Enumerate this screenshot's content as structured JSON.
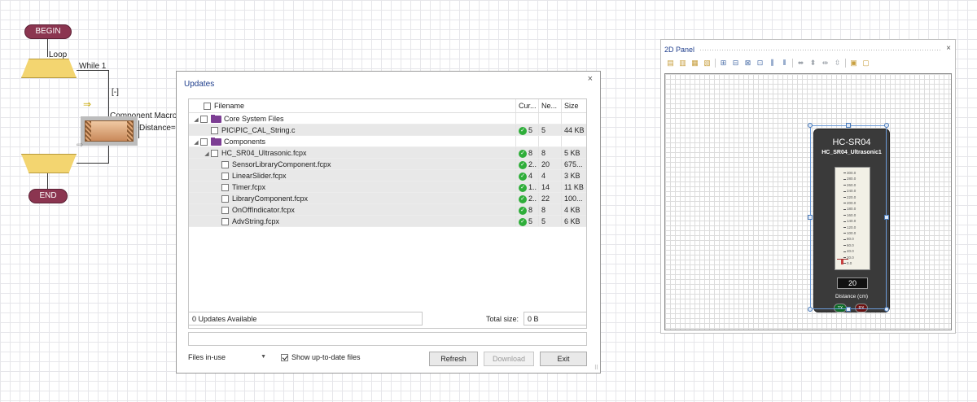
{
  "flowchart": {
    "begin_label": "BEGIN",
    "loop_label": "Loop",
    "while_label": "While 1",
    "collapse_label": "[-]",
    "macro_label": "Component Macro",
    "distance_label": "Distance=",
    "end_label": "END"
  },
  "updates": {
    "title": "Updates",
    "close_icon": "×",
    "columns": {
      "filename": "Filename",
      "current": "Cur...",
      "newest": "Ne...",
      "size": "Size"
    },
    "rows": [
      {
        "indent": 0,
        "expander": "◢",
        "folder": true,
        "name": "Core System Files",
        "current": "",
        "newest": "",
        "size": "",
        "ok": false,
        "alt": false
      },
      {
        "indent": 1,
        "expander": "",
        "folder": false,
        "name": "PIC\\PIC_CAL_String.c",
        "current": "5",
        "newest": "5",
        "size": "44 KB",
        "ok": true,
        "alt": true
      },
      {
        "indent": 0,
        "expander": "◢",
        "folder": true,
        "name": "Components",
        "current": "",
        "newest": "",
        "size": "",
        "ok": false,
        "alt": false
      },
      {
        "indent": 1,
        "expander": "◢",
        "folder": false,
        "name": "HC_SR04_Ultrasonic.fcpx",
        "current": "8",
        "newest": "8",
        "size": "5 KB",
        "ok": true,
        "alt": true
      },
      {
        "indent": 2,
        "expander": "",
        "folder": false,
        "name": "SensorLibraryComponent.fcpx",
        "current": "2..",
        "newest": "20",
        "size": "675...",
        "ok": true,
        "alt": true
      },
      {
        "indent": 2,
        "expander": "",
        "folder": false,
        "name": "LinearSlider.fcpx",
        "current": "4",
        "newest": "4",
        "size": "3 KB",
        "ok": true,
        "alt": true
      },
      {
        "indent": 2,
        "expander": "",
        "folder": false,
        "name": "Timer.fcpx",
        "current": "1..",
        "newest": "14",
        "size": "11 KB",
        "ok": true,
        "alt": true
      },
      {
        "indent": 2,
        "expander": "",
        "folder": false,
        "name": "LibraryComponent.fcpx",
        "current": "2..",
        "newest": "22",
        "size": "100...",
        "ok": true,
        "alt": true
      },
      {
        "indent": 2,
        "expander": "",
        "folder": false,
        "name": "OnOffIndicator.fcpx",
        "current": "8",
        "newest": "8",
        "size": "4 KB",
        "ok": true,
        "alt": true
      },
      {
        "indent": 2,
        "expander": "",
        "folder": false,
        "name": "AdvString.fcpx",
        "current": "5",
        "newest": "5",
        "size": "6 KB",
        "ok": true,
        "alt": true
      }
    ],
    "status": "0 Updates Available",
    "total_size_label": "Total size:",
    "total_size_value": "0 B",
    "progress_text": "",
    "filter_selected": "Files in-use",
    "show_uptodate_label": "Show up-to-date files",
    "show_uptodate_checked": true,
    "refresh_label": "Refresh",
    "download_label": "Download",
    "exit_label": "Exit"
  },
  "panel": {
    "title": "2D Panel",
    "close_icon": "×",
    "toolbar_icons": [
      "align-left-icon",
      "align-center-icon",
      "align-right-icon",
      "align-top-icon",
      "align-middle-icon",
      "align-bottom-icon",
      "distribute-h-icon",
      "distribute-v-icon",
      "space-h-icon",
      "space-v-icon",
      "size-width-icon",
      "size-height-icon",
      "center-h-icon",
      "center-v-icon",
      "group-icon",
      "ungroup-icon"
    ],
    "sensor": {
      "title": "HC-SR04",
      "subtitle": "HC_SR04_Ultrasonic1",
      "ticks": [
        "300.0",
        "280.0",
        "260.0",
        "240.0",
        "220.0",
        "200.0",
        "180.0",
        "160.0",
        "140.0",
        "120.0",
        "100.0",
        "80.0",
        "60.0",
        "40.0",
        "20.0",
        "0.0"
      ],
      "reading": "20",
      "label": "Distance (cm)",
      "tx_label": "TX",
      "rx_label": "RX",
      "level_fraction": 0.067
    }
  }
}
